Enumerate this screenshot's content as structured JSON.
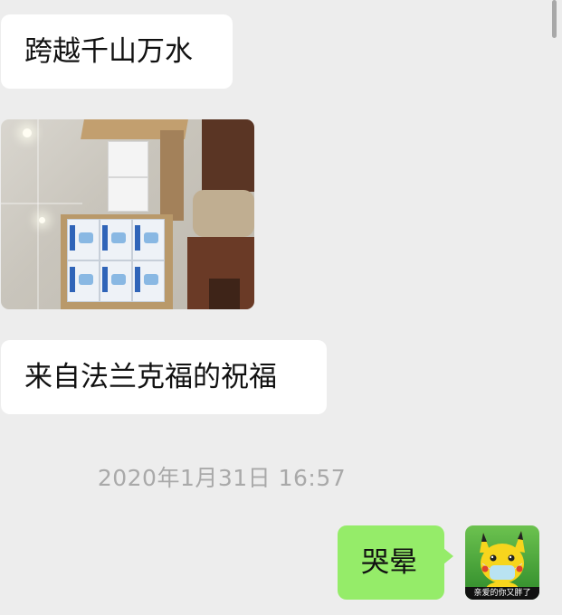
{
  "messages": [
    {
      "side": "left",
      "type": "text",
      "text": "跨越千山万水"
    },
    {
      "side": "left",
      "type": "image",
      "image_subject": "cardboard boxes of medical masks on a tiled floor"
    },
    {
      "side": "left",
      "type": "text",
      "text": "来自法兰克福的祝福"
    },
    {
      "type": "timestamp",
      "text": "2020年1月31日 16:57"
    },
    {
      "side": "right",
      "type": "text",
      "text": "哭晕"
    }
  ],
  "avatar": {
    "caption": "亲爱的你又胖了",
    "icon": "pikachu-with-mask-icon"
  },
  "colors": {
    "background": "#ededed",
    "incoming_bubble": "#ffffff",
    "outgoing_bubble": "#95ec69",
    "timestamp_text": "#a9a9a9"
  }
}
